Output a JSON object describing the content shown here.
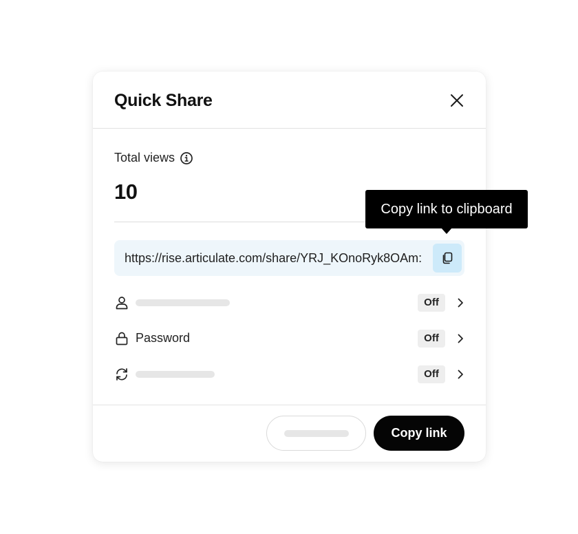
{
  "modal": {
    "title": "Quick Share"
  },
  "stats": {
    "views_label": "Total views",
    "views_count": "10"
  },
  "share": {
    "url": "https://rise.articulate.com/share/YRJ_KOnoRyk8OAm:"
  },
  "tooltip": {
    "text": "Copy link to clipboard"
  },
  "settings": [
    {
      "icon": "user-icon",
      "label": "",
      "status": "Off"
    },
    {
      "icon": "lock-icon",
      "label": "Password",
      "status": "Off"
    },
    {
      "icon": "refresh-icon",
      "label": "",
      "status": "Off"
    }
  ],
  "footer": {
    "primary_label": "Copy link"
  }
}
